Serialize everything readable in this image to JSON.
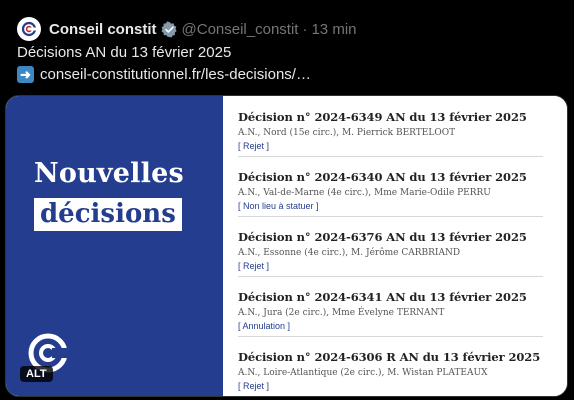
{
  "post": {
    "author_name": "Conseil constit",
    "handle": "@Conseil_constit",
    "separator": "·",
    "time": "13 min",
    "text_line1": "Décisions AN du 13 février 2025",
    "link_text": "conseil-constitutionnel.fr/les-decisions/…"
  },
  "media": {
    "headline_line1": "Nouvelles",
    "headline_line2": "décisions",
    "alt_badge": "ALT",
    "decisions": [
      {
        "title": "Décision n° 2024-6349 AN du 13 février 2025",
        "subtitle": "A.N., Nord (15e circ.), M. Pierrick BERTELOOT",
        "tag": "[ Rejet ]"
      },
      {
        "title": "Décision n° 2024-6340 AN du 13 février 2025",
        "subtitle": "A.N., Val-de-Marne (4e circ.), Mme Marie-Odile PERRU",
        "tag": "[ Non lieu à statuer ]"
      },
      {
        "title": "Décision n° 2024-6376 AN du 13 février 2025",
        "subtitle": "A.N., Essonne (4e circ.), M. Jérôme CARBRIAND",
        "tag": "[ Rejet ]"
      },
      {
        "title": "Décision n° 2024-6341 AN du 13 février 2025",
        "subtitle": "A.N., Jura (2e circ.), Mme Évelyne TERNANT",
        "tag": "[ Annulation ]"
      },
      {
        "title": "Décision n° 2024-6306 R AN du 13 février 2025",
        "subtitle": "A.N., Loire-Atlantique (2e circ.), M. Wistan PLATEAUX",
        "tag": "[ Rejet ]"
      }
    ]
  },
  "colors": {
    "brand_blue": "#253d8e",
    "verified_gray": "#829aab",
    "link_arrow_bg": "#3b88c3"
  }
}
